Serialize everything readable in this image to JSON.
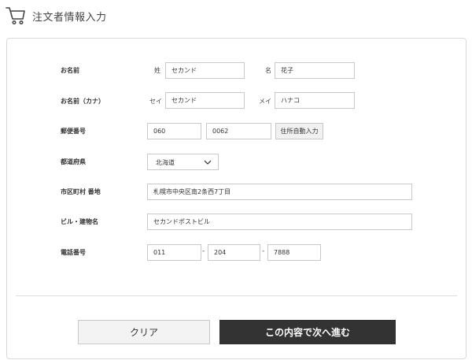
{
  "header": {
    "title": "注文者情報入力",
    "icon": "cart-icon"
  },
  "form": {
    "name": {
      "label": "お名前",
      "last_label": "姓",
      "last_value": "セカンド",
      "first_label": "名",
      "first_value": "花子"
    },
    "kana": {
      "label": "お名前（カナ）",
      "last_label": "セイ",
      "last_value": "セカンド",
      "first_label": "メイ",
      "first_value": "ハナコ"
    },
    "postal": {
      "label": "郵便番号",
      "part1": "060",
      "part2": "0062",
      "button_label": "住所自動入力"
    },
    "prefecture": {
      "label": "都道府県",
      "selected": "北海道"
    },
    "city": {
      "label": "市区町村 番地",
      "value": "札幌市中央区南2条西7丁目"
    },
    "building": {
      "label": "ビル・建物名",
      "value": "セカンドポストビル"
    },
    "phone": {
      "label": "電話番号",
      "part1": "011",
      "part2": "204",
      "part3": "7888",
      "separator": "-"
    }
  },
  "actions": {
    "clear_label": "クリア",
    "next_label": "この内容で次へ進む"
  }
}
